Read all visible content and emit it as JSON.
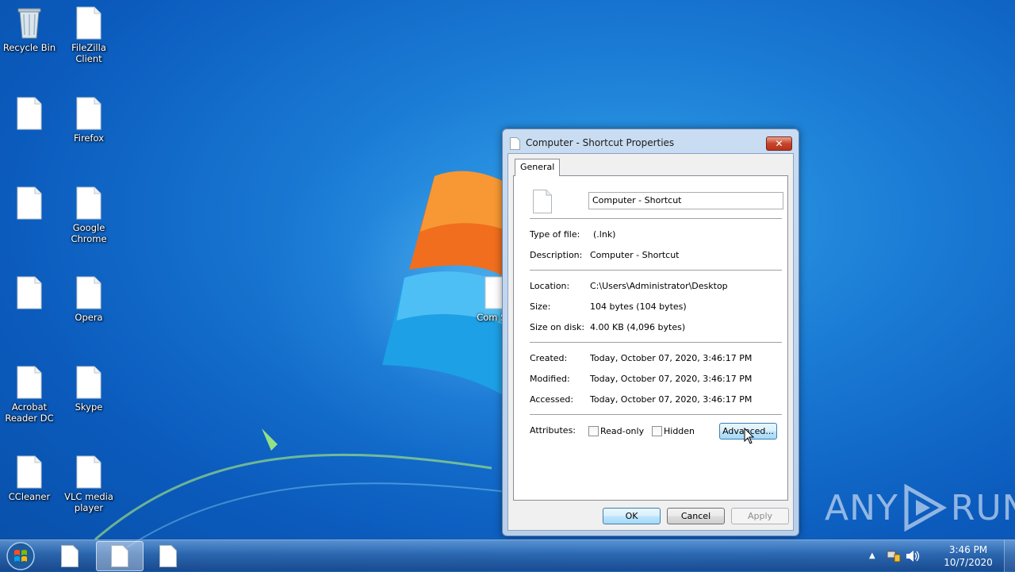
{
  "desktop": {
    "icons": [
      {
        "label": "Recycle Bin"
      },
      {
        "label": "FileZilla Client"
      },
      {
        "label": ""
      },
      {
        "label": "Firefox"
      },
      {
        "label": ""
      },
      {
        "label": "Google Chrome"
      },
      {
        "label": ""
      },
      {
        "label": "Opera"
      },
      {
        "label": "Acrobat Reader DC"
      },
      {
        "label": "Skype"
      },
      {
        "label": "CCleaner"
      },
      {
        "label": "VLC media player"
      }
    ],
    "hidden_icon_label": "Com Sho"
  },
  "dialog": {
    "title": "Computer - Shortcut Properties",
    "close_symbol": "✕",
    "tab_general": "General",
    "name_value": "Computer - Shortcut",
    "type_label": "Type of file:",
    "type_value": "(.lnk)",
    "description_label": "Description:",
    "description_value": "Computer - Shortcut",
    "location_label": "Location:",
    "location_value": "C:\\Users\\Administrator\\Desktop",
    "size_label": "Size:",
    "size_value": "104 bytes (104 bytes)",
    "size_on_disk_label": "Size on disk:",
    "size_on_disk_value": "4.00 KB (4,096 bytes)",
    "created_label": "Created:",
    "created_value": "Today, October 07, 2020, 3:46:17 PM",
    "modified_label": "Modified:",
    "modified_value": "Today, October 07, 2020, 3:46:17 PM",
    "accessed_label": "Accessed:",
    "accessed_value": "Today, October 07, 2020, 3:46:17 PM",
    "attributes_label": "Attributes:",
    "readonly_label": "Read-only",
    "hidden_label": "Hidden",
    "advanced_button": "Advanced...",
    "ok_button": "OK",
    "cancel_button": "Cancel",
    "apply_button": "Apply"
  },
  "watermark": {
    "text_left": "ANY",
    "text_right": "RUN"
  },
  "taskbar": {
    "clock_time": "3:46 PM",
    "clock_date": "10/7/2020",
    "tray_arrow": "▲"
  },
  "colors": {
    "desktop_blue": "#1a7ad4",
    "close_red": "#c7442a",
    "focus_blue": "#3c7fb1"
  }
}
